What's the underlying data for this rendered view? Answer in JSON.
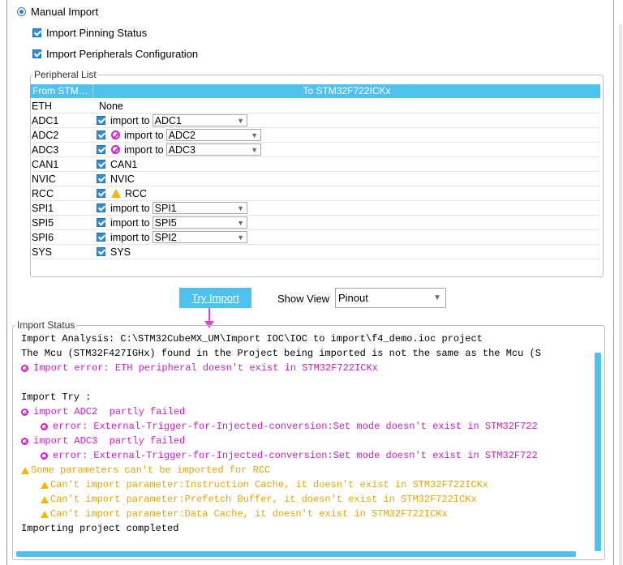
{
  "manual_import": {
    "label": "Manual Import",
    "import_pinning_status": "Import Pinning Status",
    "import_peripherals_config": "Import Peripherals Configuration"
  },
  "peripheral_list": {
    "title": "Peripheral List",
    "col_from": "From STM…",
    "col_to": "To STM32F722ICKx",
    "rows": [
      {
        "name": "ETH",
        "target": "None"
      },
      {
        "name": "ADC1",
        "action": "import to",
        "target": "ADC1"
      },
      {
        "name": "ADC2",
        "action": "import to",
        "target": "ADC2"
      },
      {
        "name": "ADC3",
        "action": "import to",
        "target": "ADC3"
      },
      {
        "name": "CAN1",
        "target": "CAN1"
      },
      {
        "name": "NVIC",
        "target": "NVIC"
      },
      {
        "name": "RCC",
        "target": "RCC"
      },
      {
        "name": "SPI1",
        "action": "import to",
        "target": "SPI1"
      },
      {
        "name": "SPI5",
        "action": "import to",
        "target": "SPI5"
      },
      {
        "name": "SPI6",
        "action": "import to",
        "target": "SPI2"
      },
      {
        "name": "SYS",
        "target": "SYS"
      }
    ]
  },
  "controls": {
    "try_import": "Try Import",
    "show_view_label": "Show View",
    "show_view_value": "Pinout"
  },
  "import_status": {
    "title": "Import Status",
    "lines": [
      "Import Analysis: C:\\STM32CubeMX_UM\\Import IOC\\IOC to import\\f4_demo.ioc project",
      "The Mcu (STM32F427IGHx) found in the Project being imported is not the same as the Mcu (S",
      "Import error: ETH peripheral doesn't exist in STM32F722ICKx",
      "Import Try :",
      "import ADC2  partly failed",
      "error: External-Trigger-for-Injected-conversion:Set mode doesn't exist in STM32F722",
      "import ADC3  partly failed",
      "error: External-Trigger-for-Injected-conversion:Set mode doesn't exist in STM32F722",
      "Some parameters can't be imported for RCC",
      "Can't import parameter:Instruction Cache, it doesn't exist in STM32F722ICKx",
      "Can't import parameter:Prefetch Buffer, it doesn't exist in STM32F722ICKx",
      "Can't import parameter:Data Cache, it doesn't exist in STM32F722ICKx",
      "Importing project completed"
    ]
  },
  "colors": {
    "accent": "#4ec1ee",
    "error": "#c81ec8",
    "warning": "#e0a800"
  }
}
